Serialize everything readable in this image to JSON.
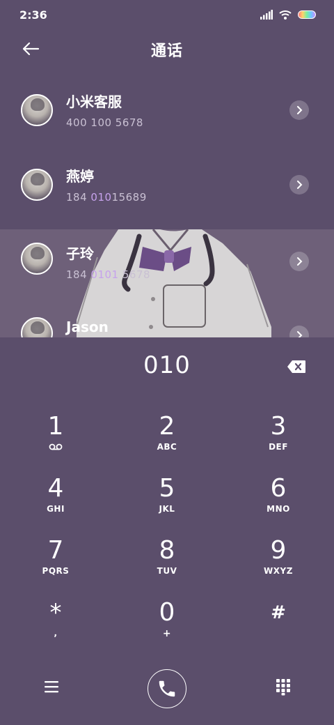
{
  "status_bar": {
    "time": "2:36",
    "icons": [
      "signal-icon",
      "wifi-icon",
      "battery-icon"
    ]
  },
  "header": {
    "title": "通话",
    "back_icon": "arrow-left-icon"
  },
  "contacts": [
    {
      "name": "小米客服",
      "number_pre": "400 ",
      "number_match": "",
      "number_post": "100 5678"
    },
    {
      "name": "燕婷",
      "number_pre": "184 ",
      "number_match": "010",
      "number_post": "15689"
    },
    {
      "name": "子玲",
      "number_pre": "184 ",
      "number_match": "0101",
      "number_post": " 5678"
    },
    {
      "name": "Jason",
      "number_pre": "",
      "number_match": "",
      "number_post": ""
    }
  ],
  "dialer": {
    "input_value": "010",
    "keys": [
      {
        "digit": "1",
        "letters": ""
      },
      {
        "digit": "2",
        "letters": "ABC"
      },
      {
        "digit": "3",
        "letters": "DEF"
      },
      {
        "digit": "4",
        "letters": "GHI"
      },
      {
        "digit": "5",
        "letters": "JKL"
      },
      {
        "digit": "6",
        "letters": "MNO"
      },
      {
        "digit": "7",
        "letters": "PQRS"
      },
      {
        "digit": "8",
        "letters": "TUV"
      },
      {
        "digit": "9",
        "letters": "WXYZ"
      },
      {
        "digit": "*",
        "letters": ","
      },
      {
        "digit": "0",
        "letters": "+"
      },
      {
        "digit": "#",
        "letters": ""
      }
    ]
  },
  "colors": {
    "background": "#5b4e6b",
    "highlight_row": "#6e6079",
    "match_text": "#c6a2ec"
  }
}
